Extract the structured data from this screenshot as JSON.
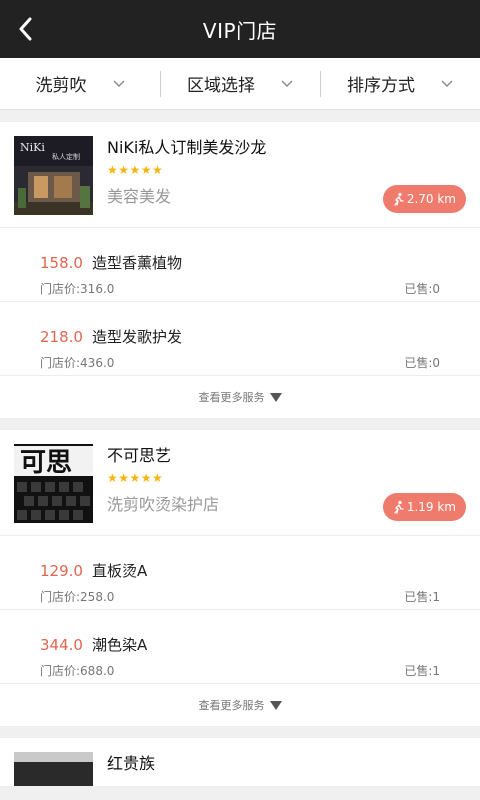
{
  "header": {
    "title": "VIP门店"
  },
  "filters": [
    {
      "label": "洗剪吹"
    },
    {
      "label": "区域选择"
    },
    {
      "label": "排序方式"
    }
  ],
  "labels": {
    "orig_prefix": "门店价:",
    "sold_prefix": "已售:",
    "more_services": "查看更多服务"
  },
  "shops": [
    {
      "name": "NiKi私人订制美发沙龙",
      "stars": "★★★★★",
      "category": "美容美发",
      "distance": "2.70 km",
      "services": [
        {
          "price": "158.0",
          "name": "造型香薰植物",
          "orig": "316.0",
          "sold": "0"
        },
        {
          "price": "218.0",
          "name": "造型发歌护发",
          "orig": "436.0",
          "sold": "0"
        }
      ]
    },
    {
      "name": "不可思艺",
      "stars": "★★★★★",
      "category": "洗剪吹烫染护店",
      "distance": "1.19 km",
      "services": [
        {
          "price": "129.0",
          "name": "直板烫A",
          "orig": "258.0",
          "sold": "1"
        },
        {
          "price": "344.0",
          "name": "潮色染A",
          "orig": "688.0",
          "sold": "1"
        }
      ]
    },
    {
      "name": "红贵族"
    }
  ],
  "colors": {
    "header_bg": "#222222",
    "price": "#e0664f",
    "distance_badge": "#ef7b6d",
    "stars": "#f5b40f"
  }
}
